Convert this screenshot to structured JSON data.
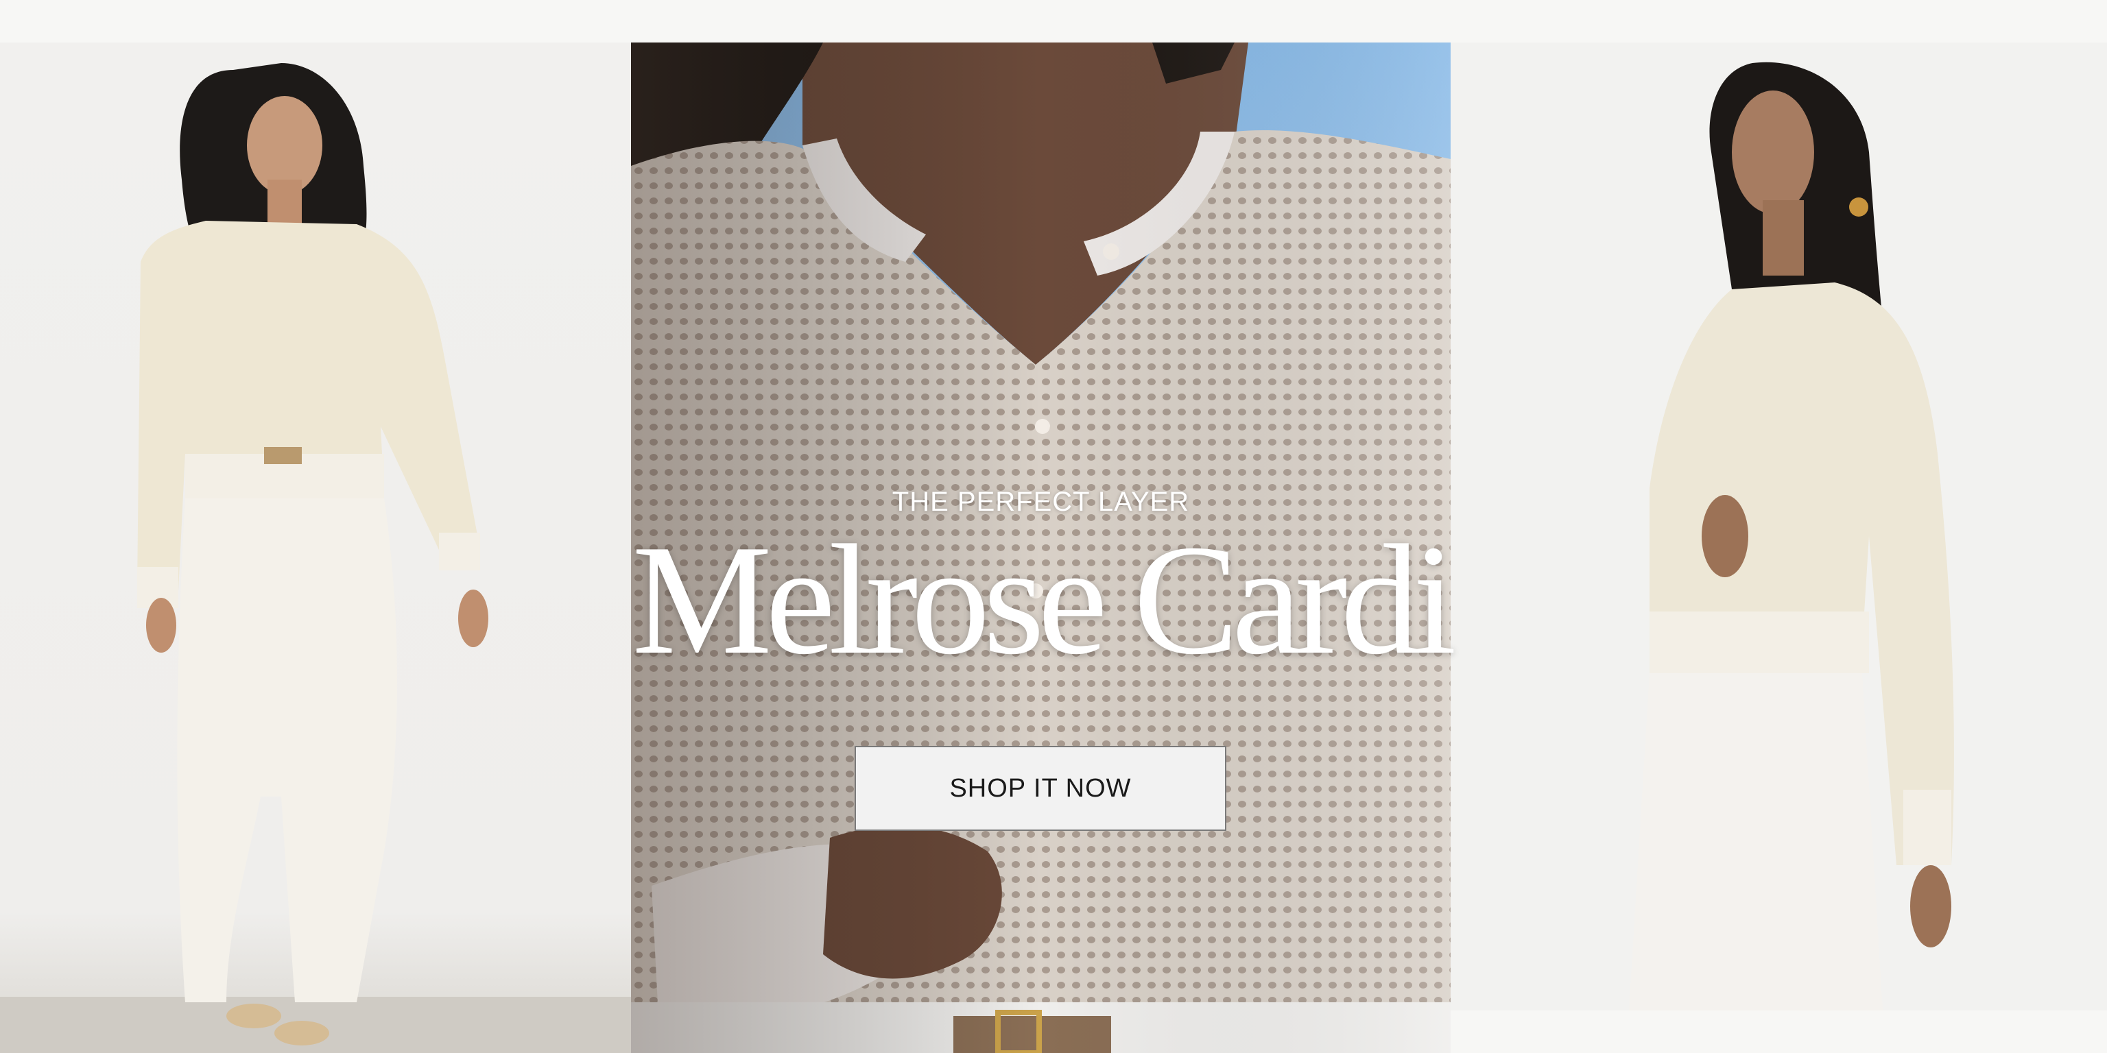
{
  "hero": {
    "eyebrow": "THE PERFECT LAYER",
    "headline": "Melrose Cardi",
    "cta_label": "SHOP IT NOW"
  },
  "images": {
    "left": "model-front-view-photo",
    "center": "cardigan-closeup-photo",
    "right": "model-side-view-photo"
  },
  "colors": {
    "page_bg": "#f7f7f5",
    "button_bg": "#f2f2f2",
    "button_text": "#1a1a1a",
    "hero_text": "#ffffff",
    "cardigan": "#efe8d6",
    "pants": "#f4f1ea"
  }
}
